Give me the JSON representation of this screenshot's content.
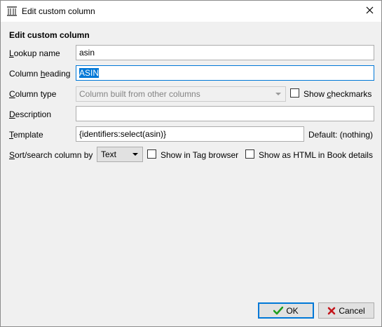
{
  "window": {
    "title": "Edit custom column",
    "app_icon": "calibre-library-icon",
    "close_icon": "close-icon"
  },
  "form": {
    "heading": "Edit custom column",
    "lookup_name": {
      "label_underlined": "L",
      "label_rest": "ookup name",
      "value": "asin"
    },
    "column_heading": {
      "label_pre": "Column ",
      "label_underlined": "h",
      "label_rest": "eading",
      "value": "ASIN",
      "selected": true
    },
    "column_type": {
      "label_pre": "",
      "label_underlined": "C",
      "label_rest": "olumn type",
      "value": "Column built from other columns",
      "disabled": true
    },
    "show_checkmarks": {
      "label_pre": "Show ",
      "label_underlined": "c",
      "label_rest": "heckmarks",
      "checked": false
    },
    "description": {
      "label_underlined": "D",
      "label_rest": "escription",
      "value": ""
    },
    "template": {
      "label_underlined": "T",
      "label_rest": "emplate",
      "value": "{identifiers:select(asin)}",
      "default_text": "Default: (nothing)"
    },
    "sort_search": {
      "label_underlined": "S",
      "label_rest": "ort/search column by",
      "value": "Text"
    },
    "show_in_tag_browser": {
      "label": "Show in Tag browser",
      "checked": false
    },
    "show_as_html": {
      "label": "Show as HTML in Book details",
      "checked": false
    }
  },
  "buttons": {
    "ok": {
      "label": "OK",
      "icon": "checkmark-icon",
      "icon_color": "#1e9e1e"
    },
    "cancel": {
      "label": "Cancel",
      "icon": "x-icon",
      "icon_color": "#c4161c"
    }
  },
  "colors": {
    "accent": "#0078d7"
  }
}
